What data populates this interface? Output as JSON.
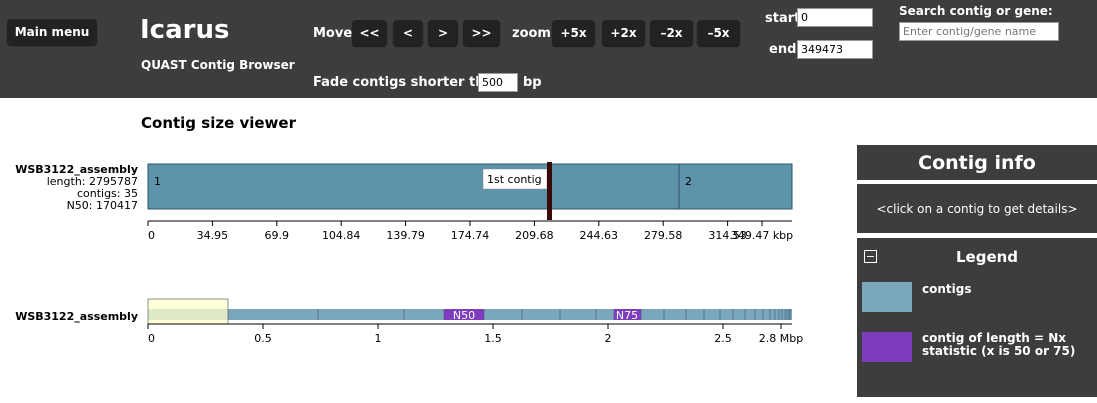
{
  "header": {
    "main_menu": "Main menu",
    "app_title": "Icarus",
    "app_subtitle": "QUAST Contig Browser",
    "move_label": "Move",
    "move_buttons": [
      "<<",
      "<",
      ">",
      ">>"
    ],
    "zoom_label": "zoom",
    "zoom_buttons": [
      "+5x",
      "+2x",
      "–2x",
      "–5x"
    ],
    "fade_label": "Fade contigs shorter than",
    "fade_value": "500",
    "fade_unit": "bp",
    "start_label": "start",
    "start_value": "0",
    "end_label": "end",
    "end_value": "349473",
    "search_label": "Search contig or gene:",
    "search_placeholder": "Enter contig/gene name"
  },
  "viewer": {
    "section_title": "Contig size viewer",
    "assembly": {
      "name": "WSB3122_assembly",
      "length": "length: 2795787",
      "contigs": "contigs: 35",
      "n50": "N50: 170417"
    },
    "detail_track": {
      "contig_labels": [
        "1",
        "2"
      ],
      "first_contig_label": "1st contig",
      "ticks": [
        "0",
        "34.95",
        "69.9",
        "104.84",
        "139.79",
        "174.74",
        "209.68",
        "244.63",
        "279.58",
        "314.53",
        "349.47 kbp"
      ]
    },
    "overview_track": {
      "name": "WSB3122_assembly",
      "n50_label": "N50",
      "n75_label": "N75",
      "ticks": [
        "0",
        "0.5",
        "1",
        "1.5",
        "2",
        "2.5",
        "2.8 Mbp"
      ]
    }
  },
  "contig_info": {
    "title": "Contig info",
    "hint": "<click on a contig to get details>"
  },
  "legend": {
    "collapse_symbol": "−",
    "title": "Legend",
    "items": [
      {
        "label": "contigs",
        "color": "#7ba7bc"
      },
      {
        "label": "contig of length = Nx statistic (x is 50 or 75)",
        "color": "#7d3dbc"
      }
    ]
  },
  "colors": {
    "header_bg": "#3d3d3d",
    "contig_fill": "#5d93ab",
    "overview_fill": "#7ba7bc",
    "nx_fill": "#7d3dbc",
    "selection_fill": "#ffffcc"
  }
}
